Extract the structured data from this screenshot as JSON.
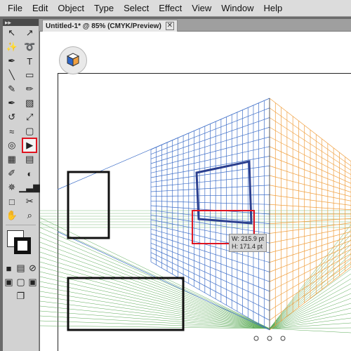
{
  "menu": [
    "File",
    "Edit",
    "Object",
    "Type",
    "Select",
    "Effect",
    "View",
    "Window",
    "Help"
  ],
  "toolbox": {
    "handle": "▸▸",
    "rows": [
      [
        {
          "name": "selection-tool-icon",
          "glyph": "↖"
        },
        {
          "name": "direct-selection-tool-icon",
          "glyph": "↗"
        }
      ],
      [
        {
          "name": "magic-wand-tool-icon",
          "glyph": "✨"
        },
        {
          "name": "lasso-tool-icon",
          "glyph": "➰"
        }
      ],
      [
        {
          "name": "pen-tool-icon",
          "glyph": "✒"
        },
        {
          "name": "type-tool-icon",
          "glyph": "T"
        }
      ],
      [
        {
          "name": "line-segment-tool-icon",
          "glyph": "╲"
        },
        {
          "name": "rectangle-tool-icon",
          "glyph": "▭"
        }
      ],
      [
        {
          "name": "paintbrush-tool-icon",
          "glyph": "✎"
        },
        {
          "name": "pencil-tool-icon",
          "glyph": "✏"
        }
      ],
      [
        {
          "name": "blob-brush-tool-icon",
          "glyph": "✒"
        },
        {
          "name": "eraser-tool-icon",
          "glyph": "▧"
        }
      ],
      [
        {
          "name": "rotate-tool-icon",
          "glyph": "↺"
        },
        {
          "name": "scale-tool-icon",
          "glyph": "⤢"
        }
      ],
      [
        {
          "name": "warp-tool-icon",
          "glyph": "≈"
        },
        {
          "name": "free-transform-tool-icon",
          "glyph": "▢"
        }
      ],
      [
        {
          "name": "shape-builder-tool-icon",
          "glyph": "◎"
        },
        {
          "name": "perspective-selection-tool-icon",
          "glyph": "▶",
          "selected": true
        }
      ],
      [
        {
          "name": "mesh-tool-icon",
          "glyph": "▦"
        },
        {
          "name": "gradient-tool-icon",
          "glyph": "▤"
        }
      ],
      [
        {
          "name": "eyedropper-tool-icon",
          "glyph": "✐"
        },
        {
          "name": "blend-tool-icon",
          "glyph": "◐"
        }
      ],
      [
        {
          "name": "symbol-sprayer-tool-icon",
          "glyph": "✵"
        },
        {
          "name": "column-graph-tool-icon",
          "glyph": "▁▃▆"
        }
      ],
      [
        {
          "name": "artboard-tool-icon",
          "glyph": "□"
        },
        {
          "name": "slice-tool-icon",
          "glyph": "✂"
        }
      ],
      [
        {
          "name": "hand-tool-icon",
          "glyph": "✋"
        },
        {
          "name": "zoom-tool-icon",
          "glyph": "⌕"
        }
      ]
    ],
    "bottom_rows": [
      [
        {
          "name": "color-mode-icon",
          "glyph": "■"
        },
        {
          "name": "gradient-mode-icon",
          "glyph": "▤"
        },
        {
          "name": "none-mode-icon",
          "glyph": "⊘"
        }
      ],
      [
        {
          "name": "draw-normal-icon",
          "glyph": "▣"
        },
        {
          "name": "draw-behind-icon",
          "glyph": "▢"
        },
        {
          "name": "draw-inside-icon",
          "glyph": "▣"
        }
      ],
      [
        {
          "name": "screen-mode-icon",
          "glyph": "❐"
        }
      ]
    ]
  },
  "document_tab": {
    "title": "Untitled-1* @ 85% (CMYK/Preview)",
    "close": "✕"
  },
  "tooltip": {
    "width": "W: 215.9 pt",
    "height": "H: 171.4 pt"
  },
  "colors": {
    "left_grid": "#3f6fc8",
    "right_grid": "#f0a040",
    "ground_grid": "#5aaa55",
    "highlight": "#e0141f",
    "window_frame": "#2b3f8f"
  }
}
